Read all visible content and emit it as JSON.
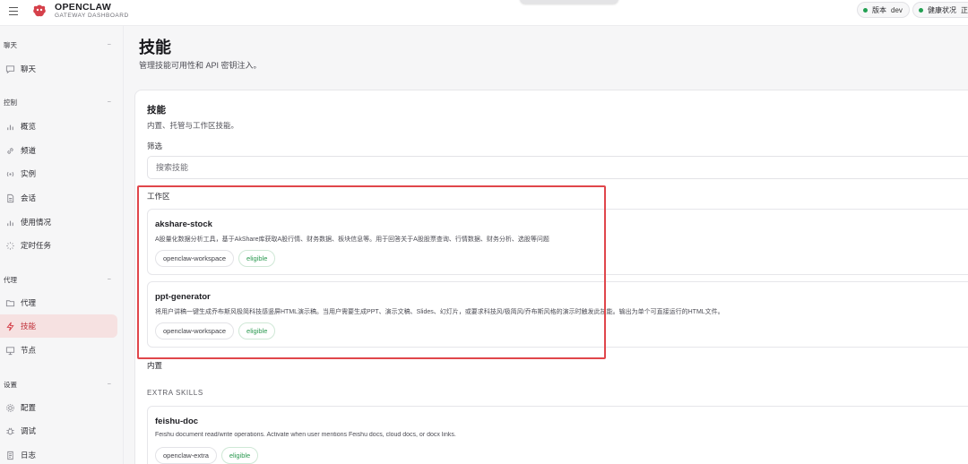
{
  "header": {
    "brand_name": "OPENCLAW",
    "brand_sub": "GATEWAY DASHBOARD",
    "version_label": "版本",
    "version_value": "dev",
    "health_label": "健康状况",
    "health_value": "正常",
    "status_color": "#22a052",
    "brand_color": "#d5404a"
  },
  "sidebar": {
    "groups": [
      {
        "label": "聊天",
        "items": [
          {
            "label": "聊天",
            "icon": "chat-icon"
          }
        ]
      },
      {
        "label": "控制",
        "items": [
          {
            "label": "概览",
            "icon": "bar-chart-icon"
          },
          {
            "label": "频道",
            "icon": "link-icon"
          },
          {
            "label": "实例",
            "icon": "broadcast-icon"
          },
          {
            "label": "会话",
            "icon": "document-icon"
          },
          {
            "label": "使用情况",
            "icon": "bar-chart-icon"
          },
          {
            "label": "定时任务",
            "icon": "loader-icon"
          }
        ]
      },
      {
        "label": "代理",
        "items": [
          {
            "label": "代理",
            "icon": "folder-icon"
          },
          {
            "label": "技能",
            "icon": "lightning-icon",
            "active": true
          },
          {
            "label": "节点",
            "icon": "monitor-icon"
          }
        ]
      },
      {
        "label": "设置",
        "items": [
          {
            "label": "配置",
            "icon": "gear-icon"
          },
          {
            "label": "调试",
            "icon": "bug-icon"
          },
          {
            "label": "日志",
            "icon": "log-icon"
          }
        ]
      }
    ],
    "collapse_glyph": "−"
  },
  "main": {
    "title": "技能",
    "subtitle": "管理技能可用性和 API 密钥注入。",
    "card": {
      "title": "技能",
      "subtitle": "内置、托管与工作区技能。",
      "filter_label": "筛选",
      "search_placeholder": "搜索技能"
    },
    "workspace_label": "工作区",
    "builtin_label": "内置",
    "extra_label": "EXTRA SKILLS",
    "skills": [
      {
        "name": "akshare-stock",
        "desc": "A股量化数据分析工具，基于AkShare库获取A股行情、财务数据、板块信息等。用于回答关于A股股票查询、行情数据、财务分析、选股等问题",
        "source": "openclaw-workspace",
        "status": "eligible"
      },
      {
        "name": "ppt-generator",
        "desc": "将用户讲稿一键生成乔布斯风极简科技感竖屏HTML演示稿。当用户需要生成PPT、演示文稿、Slides、幻灯片，或要求科技风/极简风/乔布斯风格的演示时触发此技能。输出为单个可直接运行的HTML文件。",
        "source": "openclaw-workspace",
        "status": "eligible"
      },
      {
        "name": "feishu-doc",
        "desc": "Feishu document read/write operations. Activate when user mentions Feishu docs, cloud docs, or docx links.",
        "source": "openclaw-extra",
        "status": "eligible"
      }
    ]
  }
}
